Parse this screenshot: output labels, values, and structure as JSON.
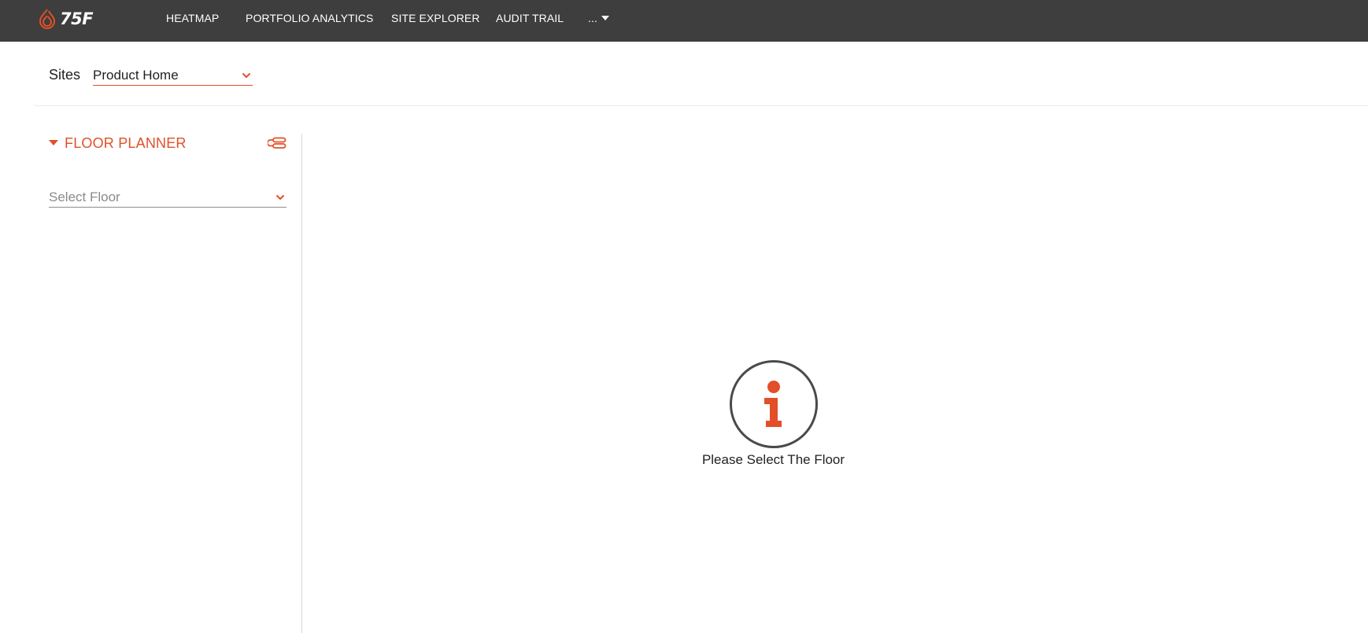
{
  "brand": {
    "logo_text": "75F",
    "accent": "#e24f28"
  },
  "nav": {
    "items": [
      {
        "label": "HEATMAP"
      },
      {
        "label": "PORTFOLIO ANALYTICS"
      },
      {
        "label": "SITE EXPLORER"
      },
      {
        "label": "AUDIT TRAIL"
      }
    ],
    "more_label": "..."
  },
  "sites": {
    "label": "Sites",
    "selected": "Product Home"
  },
  "floor_planner": {
    "title": "FLOOR PLANNER",
    "floor_select_placeholder": "Select Floor"
  },
  "main": {
    "message": "Please Select The Floor",
    "icon": "info-icon"
  }
}
